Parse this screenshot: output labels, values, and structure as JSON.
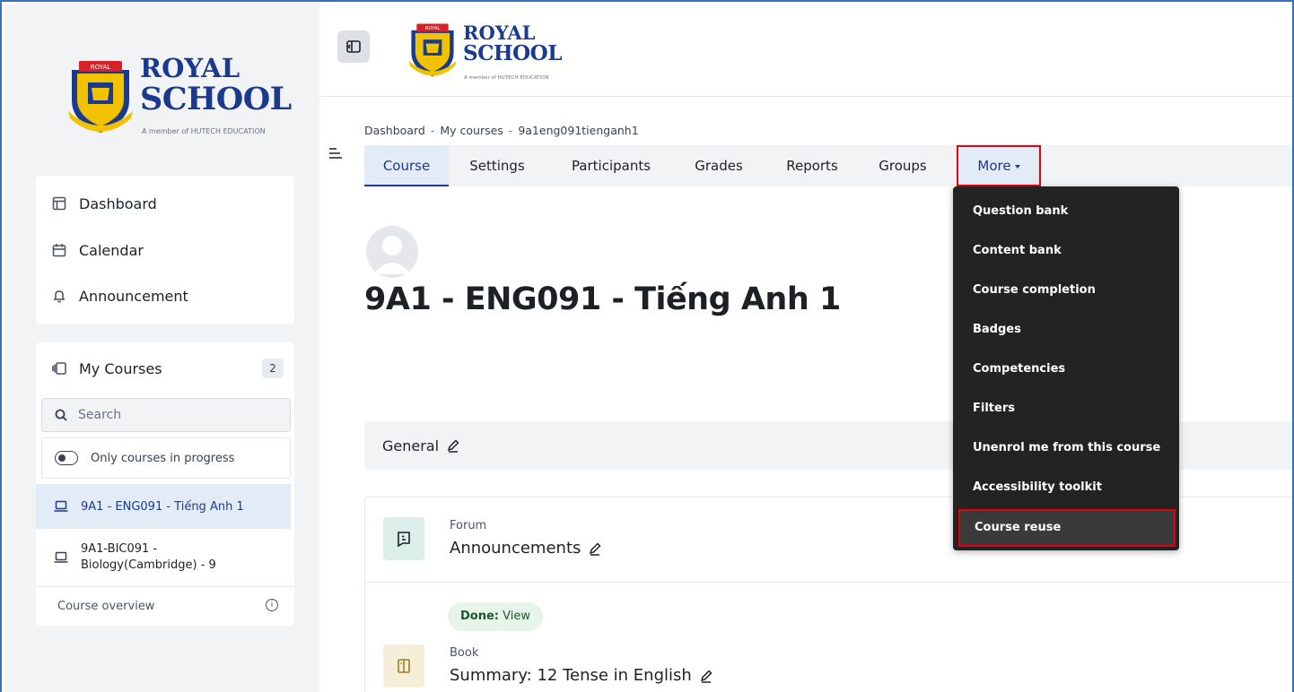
{
  "brand": {
    "top_line": "ROYAL",
    "bottom_line": "SCHOOL",
    "tagline": "A member of HUTECH EDUCATION",
    "crest_label": "ROYAL",
    "colors": {
      "navy": "#1a3a8f",
      "gold": "#f2c200",
      "red": "#d72027"
    }
  },
  "sidebar": {
    "nav": [
      {
        "label": "Dashboard",
        "icon": "dashboard-icon"
      },
      {
        "label": "Calendar",
        "icon": "calendar-icon"
      },
      {
        "label": "Announcement",
        "icon": "bell-icon"
      }
    ],
    "my_courses": {
      "title": "My Courses",
      "count": "2",
      "search_placeholder": "Search",
      "toggle_label": "Only courses in progress",
      "courses": [
        {
          "label": "9A1 - ENG091 - Tiếng Anh 1",
          "active": true
        },
        {
          "label_line1": "9A1-BIC091 -",
          "label_line2": "Biology(Cambridge) - 9",
          "active": false
        }
      ],
      "overview_label": "Course overview",
      "info_glyph": "i"
    }
  },
  "breadcrumb": [
    "Dashboard",
    "My courses",
    "9a1eng091tienganh1"
  ],
  "breadcrumb_separator": "-",
  "tabs": [
    "Course",
    "Settings",
    "Participants",
    "Grades",
    "Reports",
    "Groups",
    "More"
  ],
  "more_menu": [
    "Question bank",
    "Content bank",
    "Course completion",
    "Badges",
    "Competencies",
    "Filters",
    "Unenrol me from this course",
    "Accessibility toolkit",
    "Course reuse"
  ],
  "course": {
    "title": "9A1 - ENG091 - Tiếng Anh 1",
    "section": "General",
    "activities": [
      {
        "type": "Forum",
        "name": "Announcements",
        "icon": "forum-icon"
      },
      {
        "type": "Book",
        "name": "Summary: 12 Tense in English",
        "icon": "book-icon",
        "completion_label": "Done:",
        "completion_action": "View"
      }
    ]
  },
  "accent": {
    "highlight_border": "#e3000f",
    "active_tab_bg": "#e3ebf7",
    "menu_bg": "#232323"
  }
}
